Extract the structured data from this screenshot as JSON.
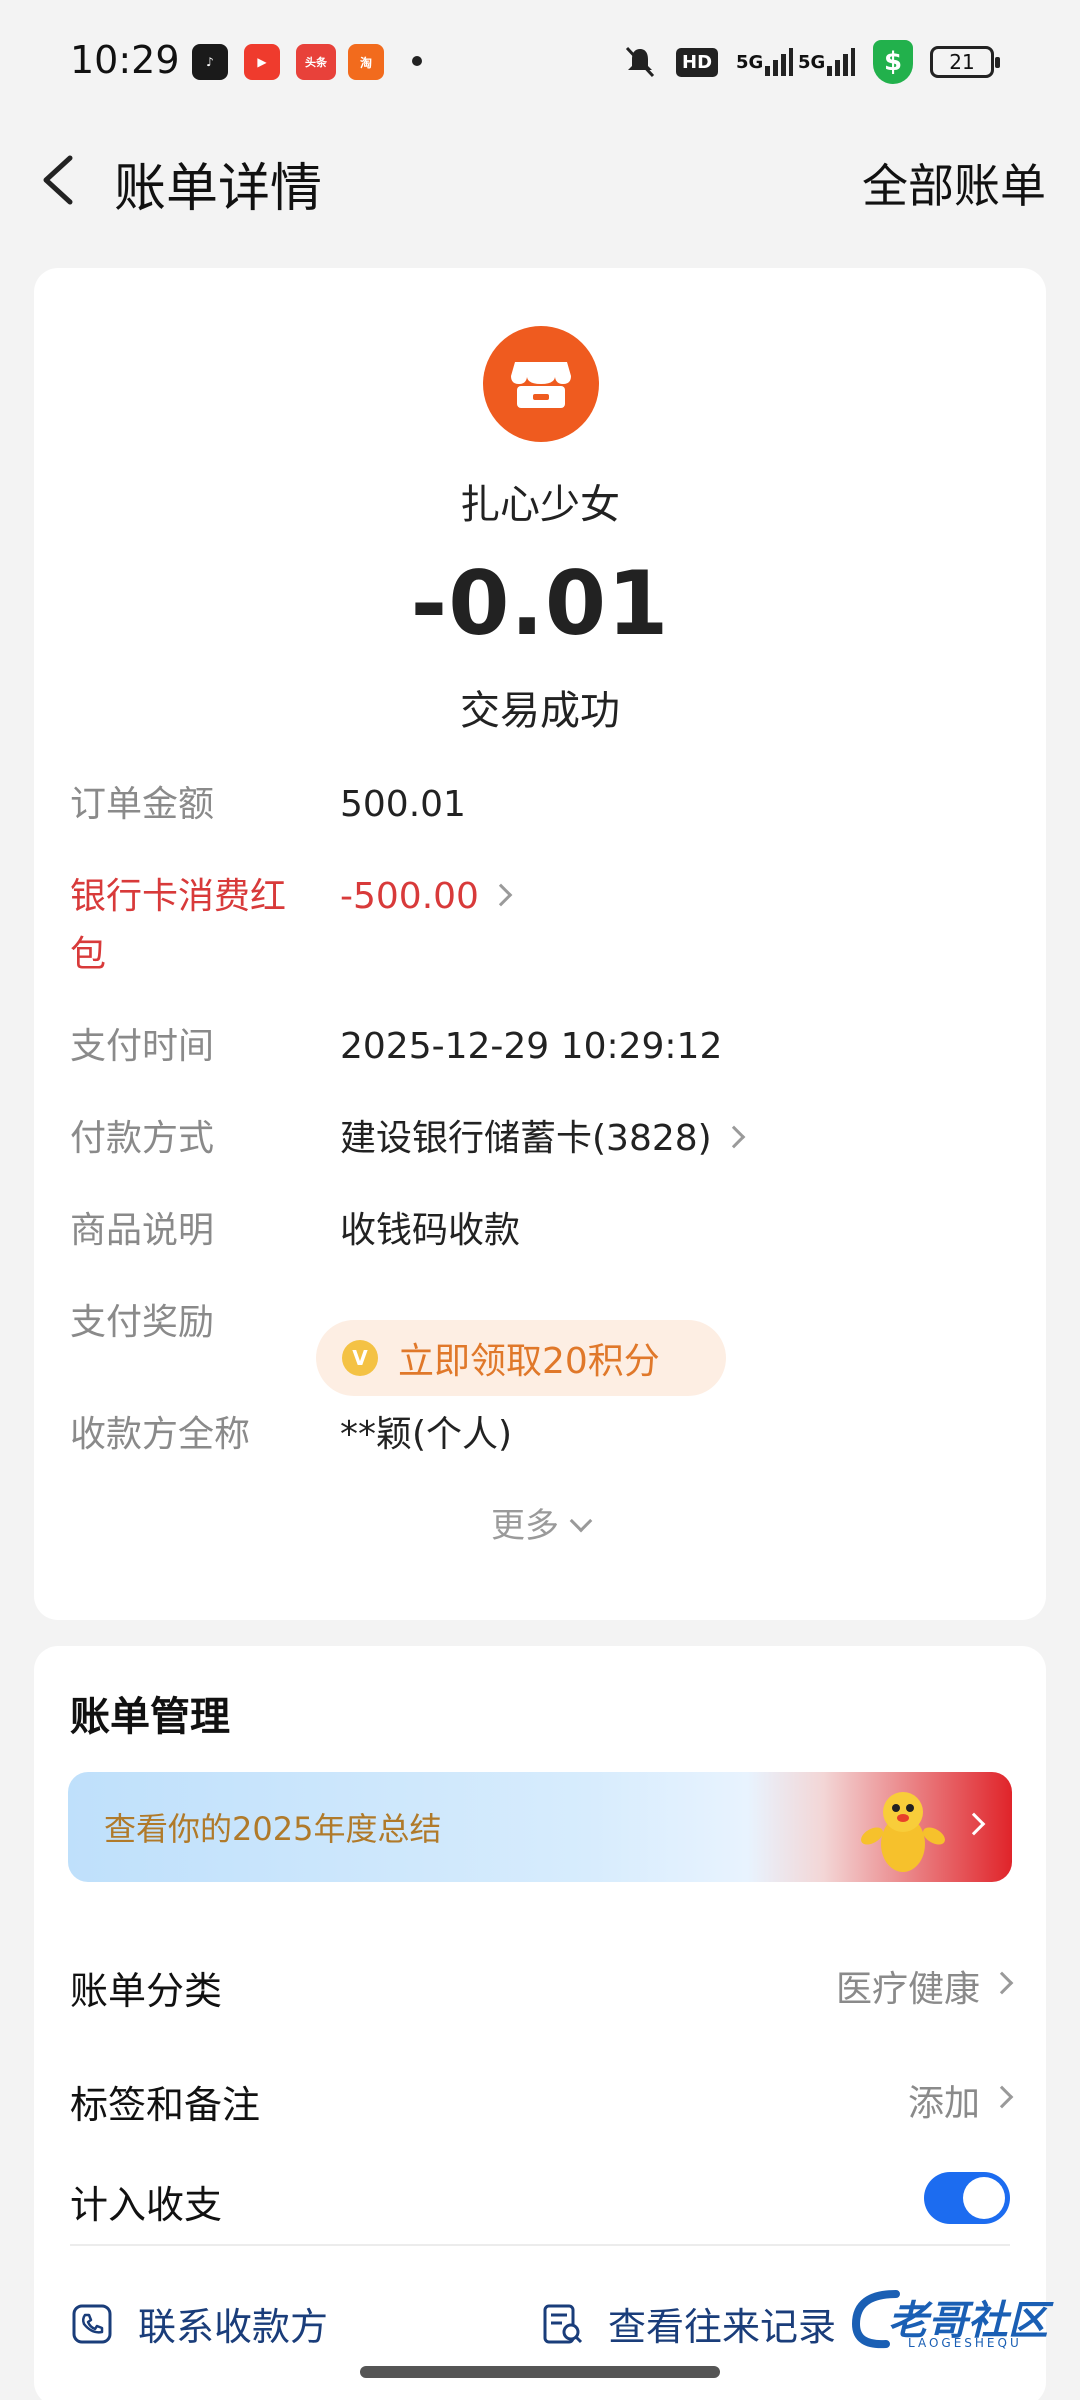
{
  "status_bar": {
    "time": "10:29",
    "battery": "21",
    "apps": [
      {
        "name": "music-app-icon",
        "color": "#1a1a1a",
        "label": "♪"
      },
      {
        "name": "video-app-icon",
        "color": "#ef3b2d",
        "label": "▶"
      },
      {
        "name": "toutiao-app-icon",
        "color": "#e8413a",
        "label": "头条"
      },
      {
        "name": "taobao-app-icon",
        "color": "#f26b1d",
        "label": "淘"
      }
    ],
    "hd_label": "HD",
    "net_label_1": "5G",
    "net_label_2": "5G"
  },
  "header": {
    "title": "账单详情",
    "all_bills": "全部账单"
  },
  "merchant": {
    "name": "扎心少女",
    "amount": "-0.01",
    "status": "交易成功"
  },
  "details": [
    {
      "label": "订单金额",
      "value": "500.01"
    },
    {
      "label": "银行卡消费红包",
      "value": "-500.00"
    },
    {
      "label": "支付时间",
      "value": "2025-12-29 10:29:12"
    },
    {
      "label": "付款方式",
      "value": "建设银行储蓄卡(3828)"
    },
    {
      "label": "商品说明",
      "value": "收钱码收款"
    },
    {
      "label": "支付奖励",
      "value": "立即领取20积分"
    },
    {
      "label": "收款方全称",
      "value": "**颖(个人)"
    }
  ],
  "more_label": "更多",
  "manage": {
    "title": "账单管理",
    "banner_text": "查看你的2025年度总结",
    "category_label": "账单分类",
    "category_value": "医疗健康",
    "tag_label": "标签和备注",
    "tag_value": "添加",
    "income_label": "计入收支",
    "income_toggle_on": true,
    "contact_label": "联系收款方",
    "history_label": "查看往来记录"
  },
  "watermark": {
    "text": "老哥社区",
    "sub": "LAOGESHEQU"
  },
  "colors": {
    "accent": "#1c6cf0",
    "merchant_logo": "#ef5b1f",
    "red_text": "#d83a3a",
    "reward_text": "#e0782a"
  }
}
